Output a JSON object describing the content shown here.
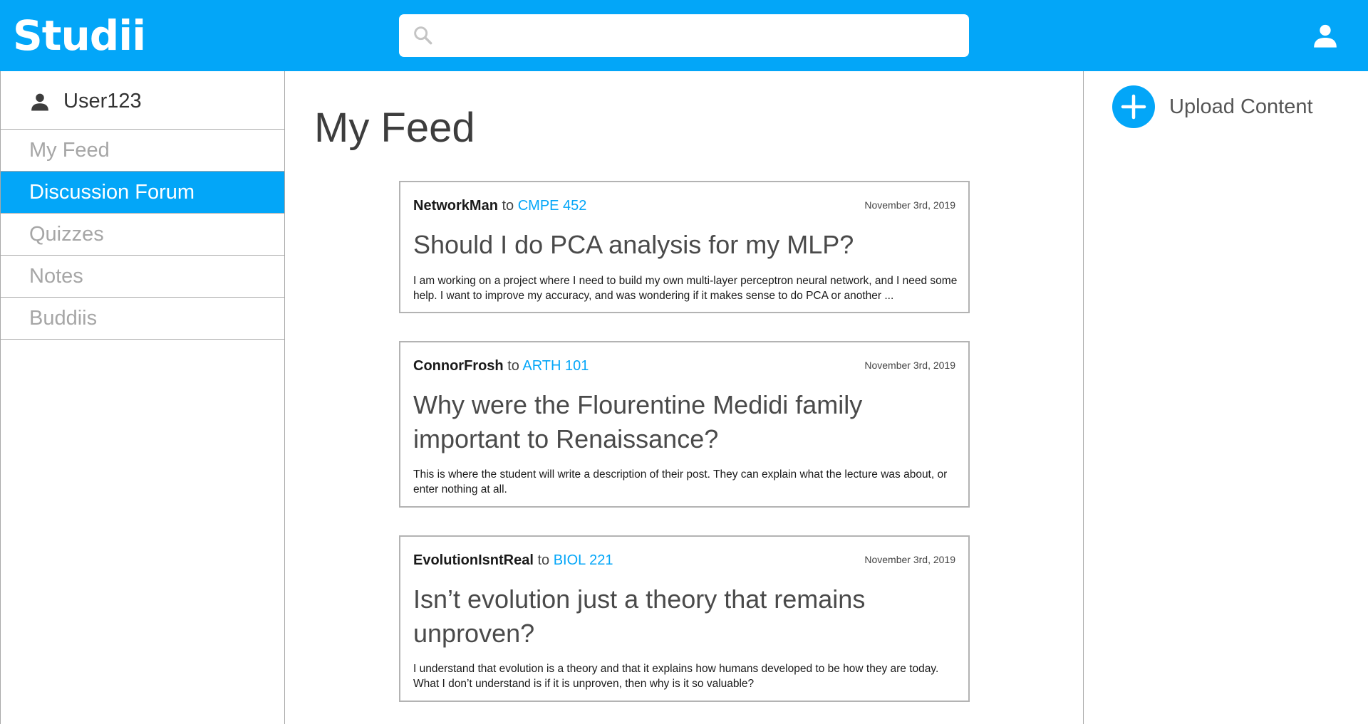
{
  "brand": {
    "logo": "Studii",
    "accent": "#03a6f8"
  },
  "search": {
    "value": "",
    "placeholder": ""
  },
  "icons": {
    "search": "search-icon",
    "profile": "user-icon",
    "sidebar_user": "user-icon",
    "upload": "plus-circle-icon"
  },
  "sidebar": {
    "user_name": "User123",
    "items": [
      {
        "label": "My Feed",
        "active": false
      },
      {
        "label": "Discussion Forum",
        "active": true
      },
      {
        "label": "Quizzes",
        "active": false
      },
      {
        "label": "Notes",
        "active": false
      },
      {
        "label": "Buddiis",
        "active": false
      }
    ]
  },
  "main": {
    "title": "My Feed",
    "posts": [
      {
        "author": "NetworkMan",
        "to": "to",
        "course": "CMPE 452",
        "date": "November 3rd, 2019",
        "title": "Should I do PCA analysis for my MLP?",
        "description": "I am working on a project where I need to build my own multi-layer perceptron neural network, and I need some help. I want to improve my accuracy, and was wondering if it makes sense to do PCA or another ..."
      },
      {
        "author": "ConnorFrosh",
        "to": "to",
        "course": "ARTH 101",
        "date": "November 3rd, 2019",
        "title": "Why were the Flourentine Medidi family important to Renaissance?",
        "description": "This is where the student will write a description of their post. They can explain what the lecture was about, or enter nothing at all."
      },
      {
        "author": "EvolutionIsntReal",
        "to": "to",
        "course": "BIOL 221",
        "date": "November 3rd, 2019",
        "title": "Isn’t evolution just a theory that remains unproven?",
        "description": "I understand that evolution is a theory and that it explains how humans developed to be how they are today. What I don’t understand is if it is unproven, then why is it so valuable?"
      }
    ]
  },
  "right_panel": {
    "upload_label": "Upload Content"
  }
}
